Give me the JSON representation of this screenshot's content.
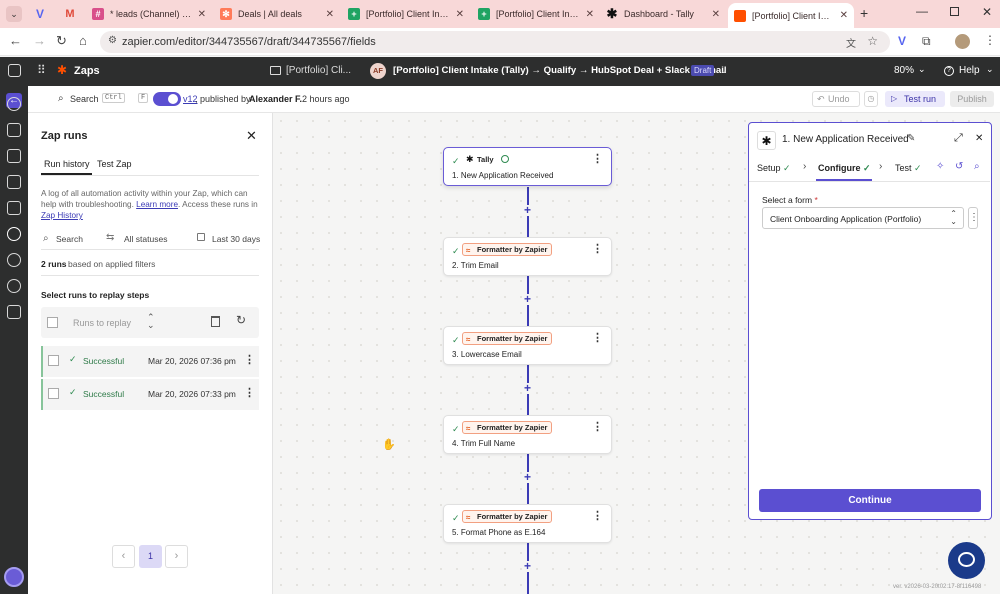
{
  "browser": {
    "tabs": [
      {
        "label": "",
        "icon": "v-icon",
        "color": "#5866f0"
      },
      {
        "label": "",
        "icon": "gmail-icon",
        "color": "#e04a3a"
      },
      {
        "label": "* leads (Channel) - Zap",
        "icon": "slack-icon",
        "color": "#d94f8a"
      },
      {
        "label": "Deals | All deals",
        "icon": "hubspot-icon",
        "color": "#ff7a59"
      },
      {
        "label": "[Portfolio] Client Intake",
        "icon": "sheets-icon",
        "color": "#1fa463"
      },
      {
        "label": "[Portfolio] Client Intake",
        "icon": "sheets-icon",
        "color": "#1fa463"
      },
      {
        "label": "Dashboard - Tally",
        "icon": "tally-icon",
        "color": "#111111"
      },
      {
        "label": "[Portfolio] Client Intake",
        "icon": "zapier-icon",
        "color": "#ff4f00"
      }
    ],
    "url": "zapier.com/editor/344735567/draft/344735567/fields"
  },
  "app": {
    "section": "Zaps",
    "folder": "[Portfolio] Cli...",
    "avatar_initials": "AF",
    "zap_title": "[Portfolio] Client Intake (Tally) → Qualify → HubSpot Deal + Slack + Email",
    "status_badge": "Draft",
    "zoom": "80%",
    "help_label": "Help"
  },
  "toolbar": {
    "search_label": "Search",
    "shortcut_keys": [
      "Ctrl",
      "F"
    ],
    "version_link": "v12",
    "published_by_prefix": ", published by",
    "published_by_name": "Alexander F.",
    "published_time": "2 hours ago",
    "undo_label": "Undo",
    "test_run_label": "Test run",
    "publish_label": "Publish"
  },
  "runs_panel": {
    "title": "Zap runs",
    "tabs": [
      "Run history",
      "Test Zap"
    ],
    "description": "A log of all automation activity within your Zap, which can help with troubleshooting.",
    "learn_more": "Learn more",
    "description_2": ". Access these runs in",
    "zap_history_link": "Zap History",
    "search_label": "Search",
    "status_filter": "All statuses",
    "date_filter": "Last 30 days",
    "runs_count": "2 runs",
    "runs_count_suffix": "based on applied filters",
    "select_heading": "Select runs to replay steps",
    "replay_placeholder": "Runs to replay",
    "runs": [
      {
        "status": "Successful",
        "date": "Mar 20, 2026 07:36 pm"
      },
      {
        "status": "Successful",
        "date": "Mar 20, 2026 07:33 pm"
      }
    ],
    "page_current": "1"
  },
  "steps": [
    {
      "app": "Tally",
      "title": "1. New Application Received",
      "selected": true
    },
    {
      "app": "Formatter by Zapier",
      "title": "2. Trim Email",
      "selected": false
    },
    {
      "app": "Formatter by Zapier",
      "title": "3. Lowercase Email",
      "selected": false
    },
    {
      "app": "Formatter by Zapier",
      "title": "4. Trim Full Name",
      "selected": false
    },
    {
      "app": "Formatter by Zapier",
      "title": "5. Format Phone as E.164",
      "selected": false
    }
  ],
  "config_panel": {
    "title": "1. New Application Received",
    "tabs": [
      "Setup",
      "Configure",
      "Test"
    ],
    "active_tab": "Configure",
    "field_label": "Select a form",
    "field_required": "*",
    "field_value": "Client Onboarding Application (Portfolio)",
    "continue_label": "Continue"
  },
  "version_string": "ver. v2026-03-20t02:17-8f116498",
  "colors": {
    "accent": "#5b4fd1",
    "success": "#2e8a50",
    "zapier_orange": "#ff4f00"
  }
}
